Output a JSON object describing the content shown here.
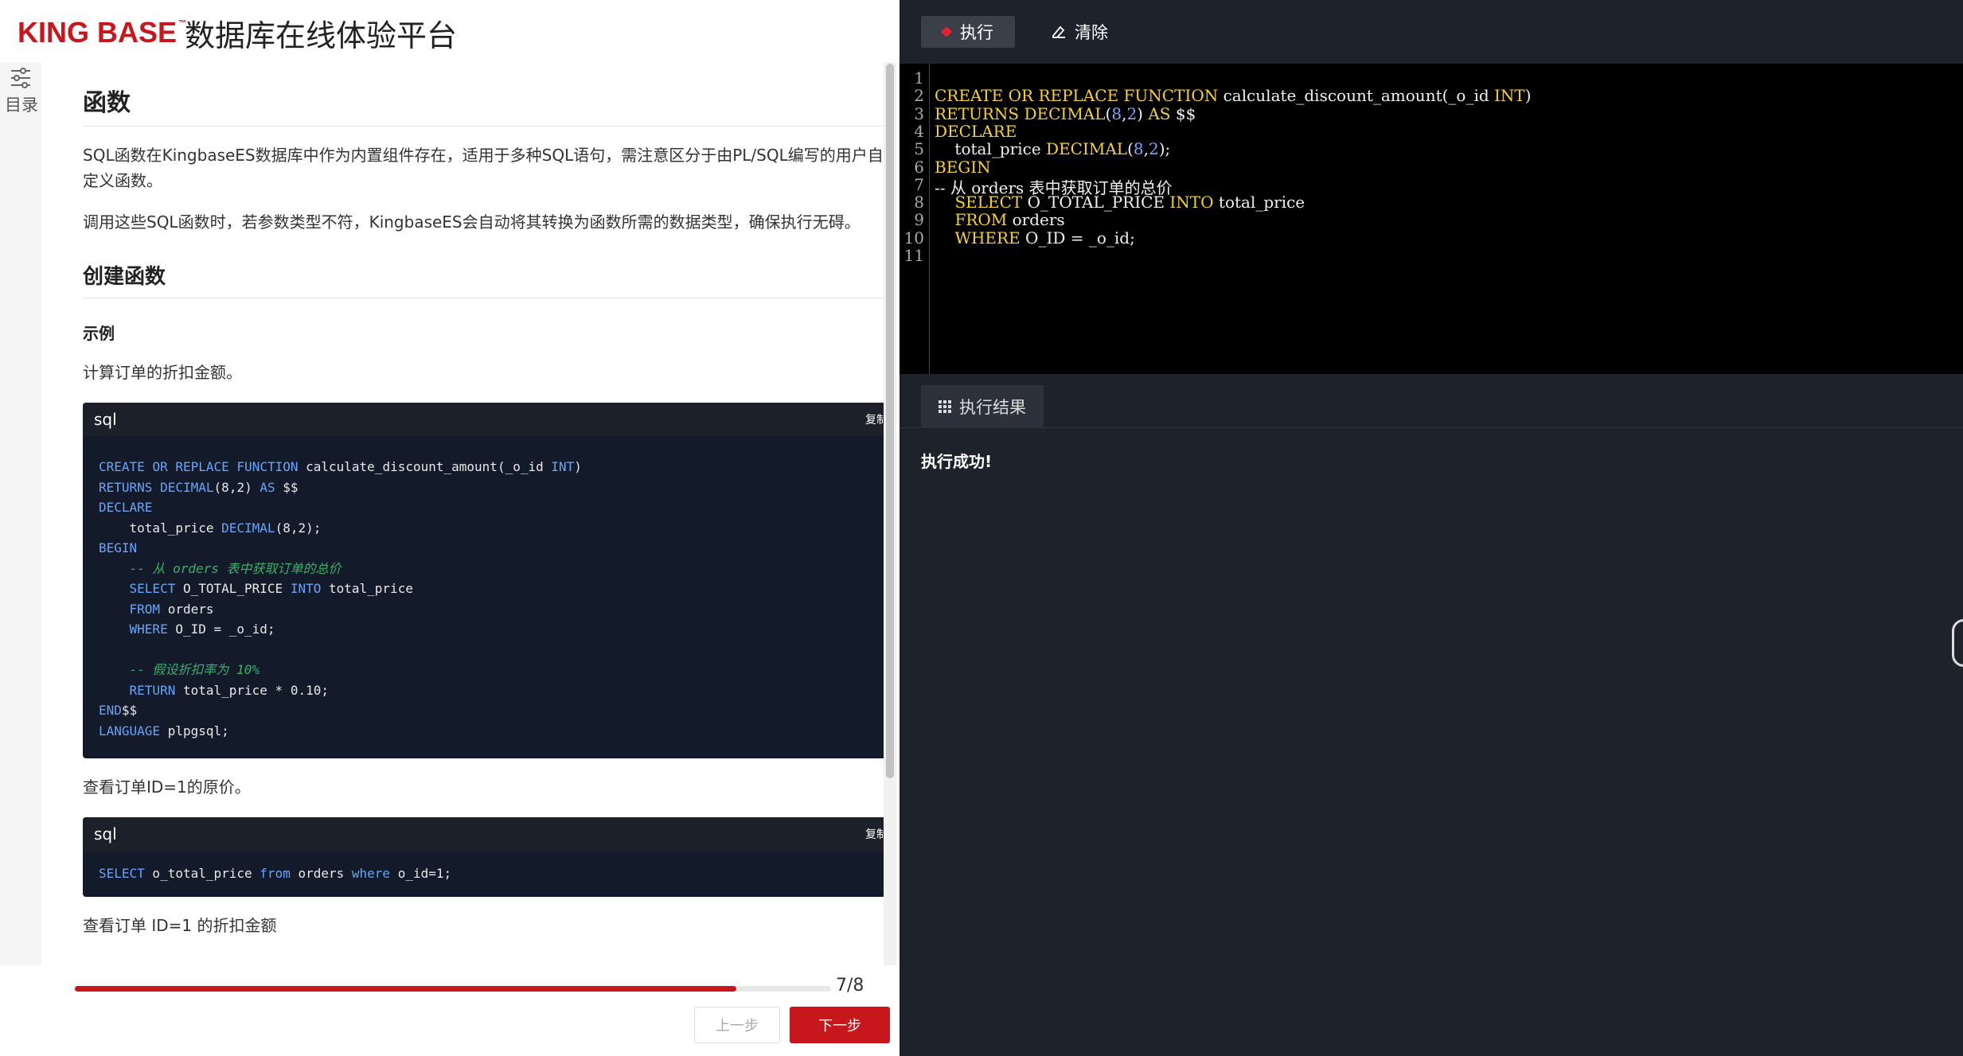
{
  "header": {
    "logo_text": "KING BASE",
    "logo_tm": "™",
    "site_title": "数据库在线体验平台"
  },
  "toc": {
    "label": "目录",
    "icon": "sliders-icon"
  },
  "article": {
    "h1": "函数",
    "p1": "SQL函数在KingbaseES数据库中作为内置组件存在，适用于多种SQL语句，需注意区分于由PL/SQL编写的用户自定义函数。",
    "p2": "调用这些SQL函数时，若参数类型不符，KingbaseES会自动将其转换为函数所需的数据类型，确保执行无碍。",
    "h2": "创建函数",
    "h4": "示例",
    "p3": "计算订单的折扣金额。",
    "code1_lang": "sql",
    "code1_copy": "复制",
    "p4": "查看订单ID=1的原价。",
    "code2_lang": "sql",
    "code2_copy": "复制",
    "code2_line": "SELECT o_total_price from orders where o_id=1;",
    "p5": "查看订单 ID=1 的折扣金额"
  },
  "code1_lines": [
    "CREATE OR REPLACE FUNCTION calculate_discount_amount(_o_id INT)",
    "RETURNS DECIMAL(8,2) AS $$",
    "DECLARE",
    "    total_price DECIMAL(8,2);",
    "BEGIN",
    "    -- 从 orders 表中获取订单的总价",
    "    SELECT O_TOTAL_PRICE INTO total_price",
    "    FROM orders",
    "    WHERE O_ID = _o_id;",
    "",
    "    -- 假设折扣率为 10%",
    "    RETURN total_price * 0.10;",
    "END$$",
    "LANGUAGE plpgsql;"
  ],
  "footer": {
    "progress_label": "7/8",
    "progress_value": 0.875,
    "prev_label": "上一步",
    "next_label": "下一步"
  },
  "toolbar": {
    "run_label": "执行",
    "clear_label": "清除"
  },
  "editor": {
    "line_numbers": [
      "1",
      "2",
      "3",
      "4",
      "5",
      "6",
      "7",
      "8",
      "9",
      "10",
      "11"
    ],
    "lines": [
      "",
      "CREATE OR REPLACE FUNCTION calculate_discount_amount(_o_id INT)",
      "RETURNS DECIMAL(8,2) AS $$",
      "DECLARE",
      "    total_price DECIMAL(8,2);",
      "BEGIN",
      "    -- 从 orders 表中获取订单的总价",
      "    SELECT O_TOTAL_PRICE INTO total_price",
      "    FROM orders",
      "    WHERE O_ID = _o_id;",
      ""
    ]
  },
  "result": {
    "tab_label": "执行结果",
    "message": "执行成功!"
  },
  "colors": {
    "brand_red": "#c8161d",
    "editor_keyword": "#f6d22b",
    "editor_number": "#7fa7ff",
    "code_keyword": "#6aa4f8",
    "code_comment": "#3cae6a"
  }
}
